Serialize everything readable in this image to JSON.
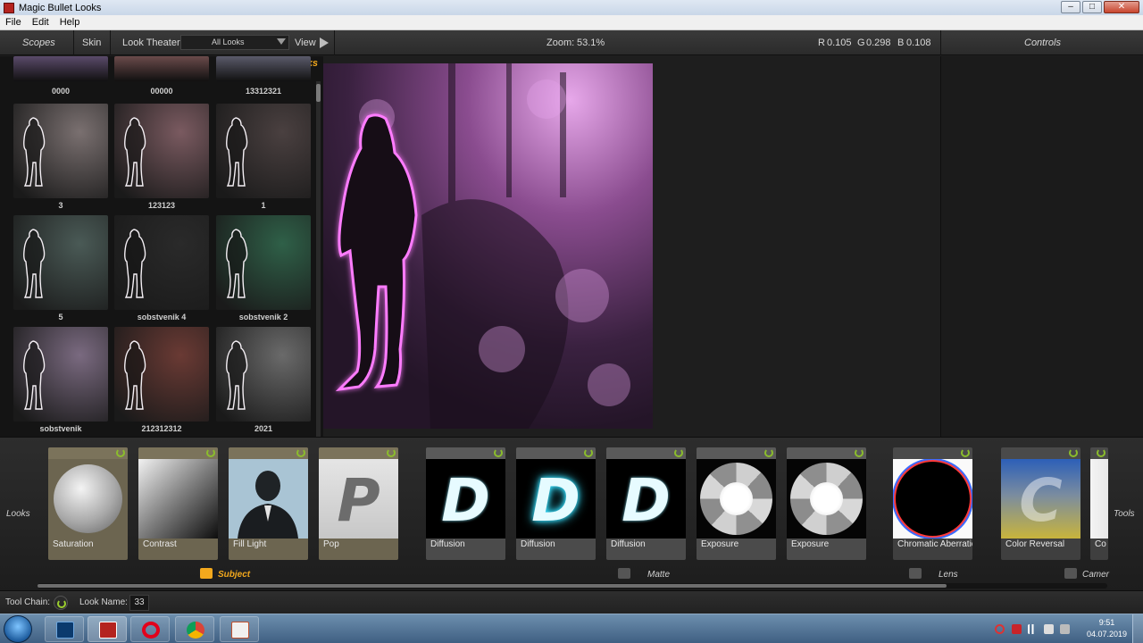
{
  "window": {
    "title": "Magic Bullet Looks",
    "minimize": "–",
    "maximize": "□",
    "close": "✕"
  },
  "menu": [
    "File",
    "Edit",
    "Help"
  ],
  "toolbar": {
    "scopes": "Scopes",
    "skin": "Skin",
    "look_theater": "Look Theater",
    "filter_value": "All Looks",
    "view": "View",
    "zoom_label": "Zoom:",
    "zoom_value": "53.1%",
    "r_label": "R",
    "r_value": "0.105",
    "g_label": "G",
    "g_value": "0.298",
    "b_label": "B",
    "b_value": "0.108",
    "controls": "Controls"
  },
  "looks_panel": {
    "header": "Looks",
    "items": [
      {
        "label": "0000",
        "tint": "#5a4a6a"
      },
      {
        "label": "00000",
        "tint": "#6a4a4a"
      },
      {
        "label": "13312321",
        "tint": "#5a5a6a"
      },
      {
        "label": "3",
        "tint": "#7a7070"
      },
      {
        "label": "123123",
        "tint": "#7a5a60"
      },
      {
        "label": "1",
        "tint": "#4a4040"
      },
      {
        "label": "5",
        "tint": "#4a5a56"
      },
      {
        "label": "sobstvenik 4",
        "tint": "#2a2a2a"
      },
      {
        "label": "sobstvenik 2",
        "tint": "#2f6048"
      },
      {
        "label": "sobstvenik",
        "tint": "#7a6a80"
      },
      {
        "label": "212312312",
        "tint": "#6a3a34"
      },
      {
        "label": "2021",
        "tint": "#6a6a6a"
      }
    ]
  },
  "tools_strip": {
    "left_label": "Looks",
    "right_label": "Tools",
    "cards": [
      {
        "name": "Saturation",
        "group": "subject",
        "icon": "sphere-icon"
      },
      {
        "name": "Contrast",
        "group": "subject",
        "icon": "gradient-icon"
      },
      {
        "name": "Fill Light",
        "group": "subject",
        "icon": "portrait-icon"
      },
      {
        "name": "Pop",
        "group": "subject",
        "icon": "letter-p-icon",
        "letter": "P"
      },
      {
        "name": "Diffusion",
        "group": "matte",
        "icon": "letter-d-icon",
        "letter": "D"
      },
      {
        "name": "Diffusion",
        "group": "matte",
        "icon": "letter-d-glow-icon",
        "letter": "D"
      },
      {
        "name": "Diffusion",
        "group": "matte",
        "icon": "letter-d-icon",
        "letter": "D"
      },
      {
        "name": "Exposure",
        "group": "matte",
        "icon": "aperture-icon"
      },
      {
        "name": "Exposure",
        "group": "matte",
        "icon": "aperture-icon"
      },
      {
        "name": "Chromatic Aberration",
        "group": "lens",
        "icon": "ring-icon"
      },
      {
        "name": "Color Reversal",
        "group": "camera",
        "icon": "letter-c-icon",
        "letter": "C"
      },
      {
        "name": "Co",
        "group": "camera",
        "icon": "partial-card-icon"
      }
    ],
    "groups": {
      "subject": "Subject",
      "matte": "Matte",
      "lens": "Lens",
      "camera": "Camer"
    }
  },
  "status": {
    "tool_chain": "Tool Chain:",
    "look_name_label": "Look Name:",
    "look_name_value": "33"
  },
  "taskbar": {
    "apps": [
      "photoshop-icon",
      "looks-app-icon",
      "opera-icon",
      "chrome-icon",
      "presentation-icon"
    ],
    "time": "9:51",
    "date": "04.07.2019"
  },
  "colors": {
    "accent": "#f2a81d",
    "power_green": "#8bbd2c",
    "preview_glow": "#ff66ff"
  }
}
